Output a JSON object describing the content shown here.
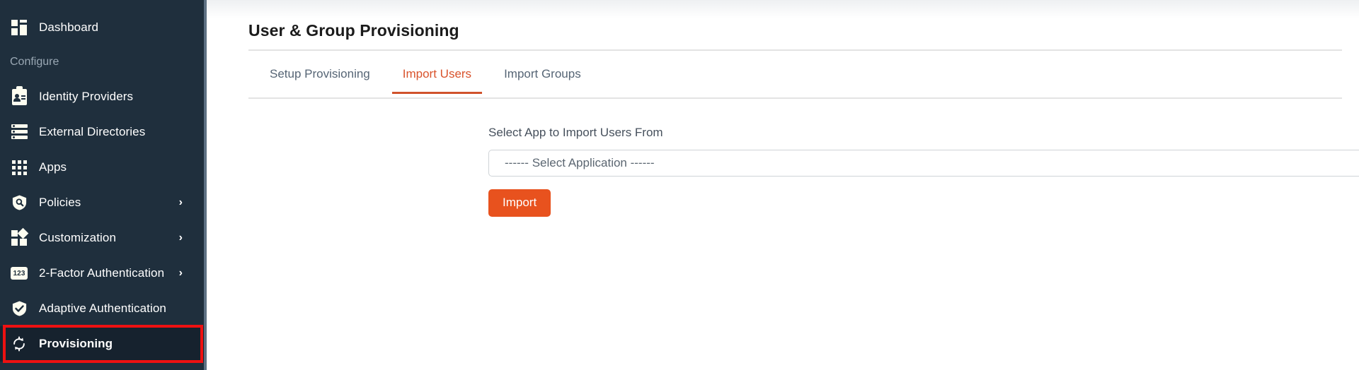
{
  "sidebar": {
    "top_items": [
      {
        "label": "Dashboard",
        "icon": "dashboard-icon",
        "chevron": false
      }
    ],
    "section_label": "Configure",
    "items": [
      {
        "label": "Identity Providers",
        "icon": "id-badge-icon",
        "chevron": false,
        "active": false
      },
      {
        "label": "External Directories",
        "icon": "directory-icon",
        "chevron": false,
        "active": false
      },
      {
        "label": "Apps",
        "icon": "apps-grid-icon",
        "chevron": false,
        "active": false
      },
      {
        "label": "Policies",
        "icon": "shield-search-icon",
        "chevron": true,
        "active": false
      },
      {
        "label": "Customization",
        "icon": "customization-icon",
        "chevron": true,
        "active": false
      },
      {
        "label": "2-Factor Authentication",
        "icon": "numeric-123-icon",
        "chevron": true,
        "active": false
      },
      {
        "label": "Adaptive Authentication",
        "icon": "shield-check-icon",
        "chevron": false,
        "active": false
      },
      {
        "label": "Provisioning",
        "icon": "sync-icon",
        "chevron": false,
        "active": true
      }
    ],
    "chevron_glyph": "›",
    "two_factor_icon_text": "123",
    "highlight_color": "#ee1111",
    "background_color": "#1f2f3d"
  },
  "main": {
    "page_title": "User & Group Provisioning",
    "tabs": [
      {
        "label": "Setup Provisioning",
        "active": false
      },
      {
        "label": "Import Users",
        "active": true
      },
      {
        "label": "Import Groups",
        "active": false
      }
    ],
    "form": {
      "field_label": "Select App to Import Users From",
      "select_value": "------ Select Application ------",
      "select_caret": "chevron-down-icon",
      "import_button_label": "Import"
    },
    "accent_color": "#e8521e",
    "active_tab_color": "#d9532c"
  }
}
